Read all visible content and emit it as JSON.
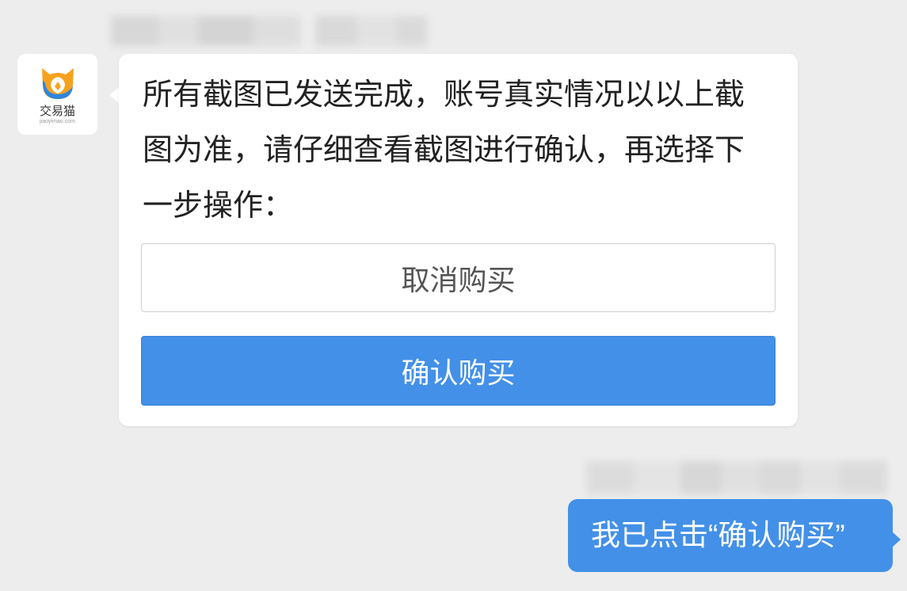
{
  "colors": {
    "background": "#ededed",
    "bubble_incoming": "#ffffff",
    "bubble_outgoing": "#4390e8",
    "button_primary": "#4390e8",
    "text_primary": "#222222",
    "text_secondary": "#555555"
  },
  "incoming_message": {
    "avatar": {
      "icon": "jiaoyimao-logo-icon",
      "brand_name": "交易猫",
      "brand_domain": "jiaoyimao.com",
      "logo_colors": {
        "orange": "#f6a21e",
        "blue": "#2b86e0"
      }
    },
    "text_lines": [
      "所有截图已发送完成，账号真实情况以以上截",
      "图为准，请仔细查看截图进行确认，再选择下",
      "一步操作："
    ],
    "cancel_button": {
      "label": "取消购买"
    },
    "confirm_button": {
      "label": "确认购买"
    }
  },
  "outgoing_message": {
    "text": "我已点击“确认购买”"
  }
}
